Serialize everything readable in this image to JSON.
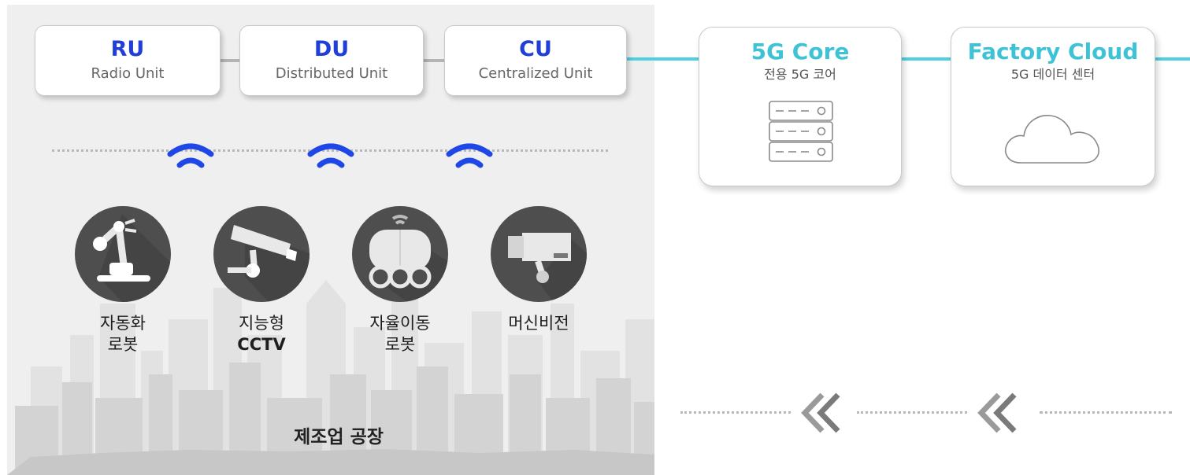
{
  "units": [
    {
      "title": "RU",
      "subtitle": "Radio Unit"
    },
    {
      "title": "DU",
      "subtitle": "Distributed Unit"
    },
    {
      "title": "CU",
      "subtitle": "Centralized Unit"
    }
  ],
  "core": [
    {
      "title": "5G Core",
      "subtitle": "전용 5G 코어",
      "icon": "server-icon"
    },
    {
      "title": "Factory Cloud",
      "subtitle": "5G 데이터 센터",
      "icon": "cloud-icon"
    }
  ],
  "devices": [
    {
      "line1": "자동화",
      "line2": "로봇",
      "icon": "robot-arm-icon"
    },
    {
      "line1": "지능형",
      "line2": "CCTV",
      "icon": "cctv-icon"
    },
    {
      "line1": "자율이동",
      "line2": "로봇",
      "icon": "mobile-robot-icon"
    },
    {
      "line1": "머신비전",
      "line2": "",
      "icon": "machine-vision-camera-icon"
    }
  ],
  "factory_title": "제조업 공장",
  "colors": {
    "unit_title": "#1f3fd8",
    "core_title": "#3ec3d6",
    "cyan_link": "#4fcfe0",
    "gray_link": "#b4b4b4",
    "wifi": "#1f46e6",
    "panel": "#efefef"
  }
}
